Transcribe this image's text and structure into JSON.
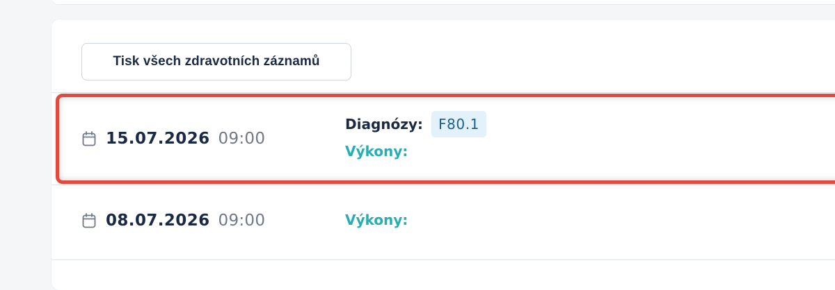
{
  "actions": {
    "print_all_label": "Tisk všech zdravotních záznamů"
  },
  "records": [
    {
      "date": "15.07.2026",
      "time": "09:00",
      "diagnoses_label": "Diagnózy:",
      "diagnoses": [
        "F80.1"
      ],
      "procedures_label": "Výkony:"
    },
    {
      "date": "08.07.2026",
      "time": "09:00",
      "procedures_label": "Výkony:"
    }
  ],
  "colors": {
    "highlight_border": "#e04b3f",
    "primary_text": "#1b2a44",
    "accent_teal": "#28aeb2",
    "badge_bg": "#e3f1fb",
    "badge_text": "#1a5f8f"
  },
  "icons": {
    "date": "calendar-icon"
  }
}
